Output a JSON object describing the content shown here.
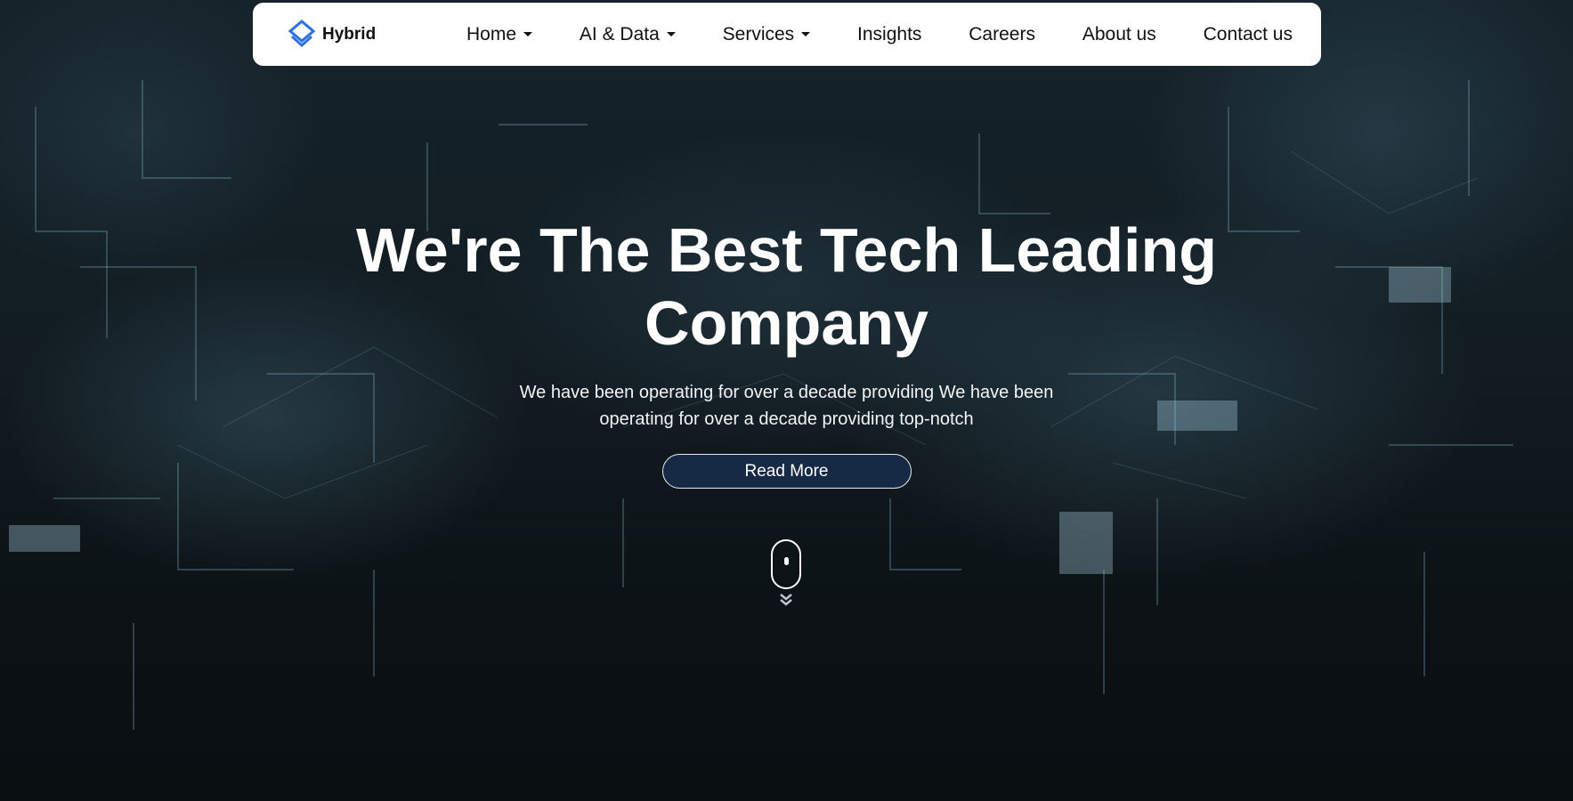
{
  "brand": {
    "name": "Hybrid",
    "logo_icon": "diamond-stack-icon",
    "logo_color": "#2f6fe4"
  },
  "nav": {
    "items": [
      {
        "label": "Home",
        "dropdown": true
      },
      {
        "label": "AI & Data",
        "dropdown": true
      },
      {
        "label": "Services",
        "dropdown": true
      },
      {
        "label": "Insights",
        "dropdown": false
      },
      {
        "label": "Careers",
        "dropdown": false
      },
      {
        "label": "About us",
        "dropdown": false
      },
      {
        "label": "Contact us",
        "dropdown": false
      }
    ]
  },
  "hero": {
    "title": "We're The Best Tech Leading Company",
    "subtitle": "We have been operating for over a decade providing We have been operating for over a decade providing top-notch",
    "cta_label": "Read More",
    "cta_color": "#172a45",
    "scroll_icon": "mouse-scroll-icon"
  }
}
